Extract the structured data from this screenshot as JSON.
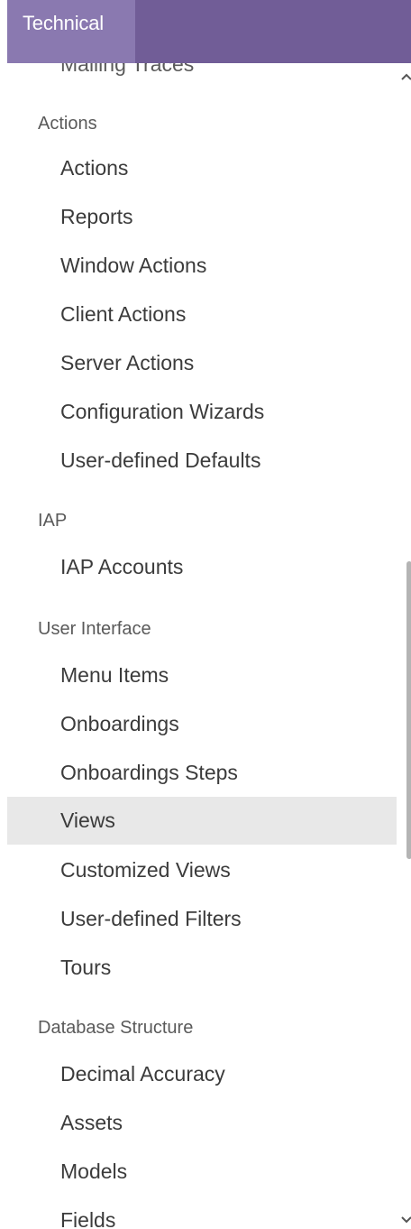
{
  "header": {
    "title": "Technical",
    "bar_color": "#715d97",
    "tab_color": "#8a79b0"
  },
  "cut_off_top_item": "Mailing Traces",
  "sections": {
    "actions": {
      "title": "Actions",
      "items": [
        "Actions",
        "Reports",
        "Window Actions",
        "Client Actions",
        "Server Actions",
        "Configuration Wizards",
        "User-defined Defaults"
      ]
    },
    "iap": {
      "title": "IAP",
      "items": [
        "IAP Accounts"
      ]
    },
    "user_interface": {
      "title": "User Interface",
      "items": [
        "Menu Items",
        "Onboardings",
        "Onboardings Steps",
        "Views",
        "Customized Views",
        "User-defined Filters",
        "Tours"
      ]
    },
    "database_structure": {
      "title": "Database Structure",
      "items": [
        "Decimal Accuracy",
        "Assets",
        "Models",
        "Fields"
      ]
    }
  },
  "active_item": "Views",
  "scrollbar": {
    "up_icon": "chevron-up-icon",
    "down_icon": "chevron-down-icon"
  }
}
